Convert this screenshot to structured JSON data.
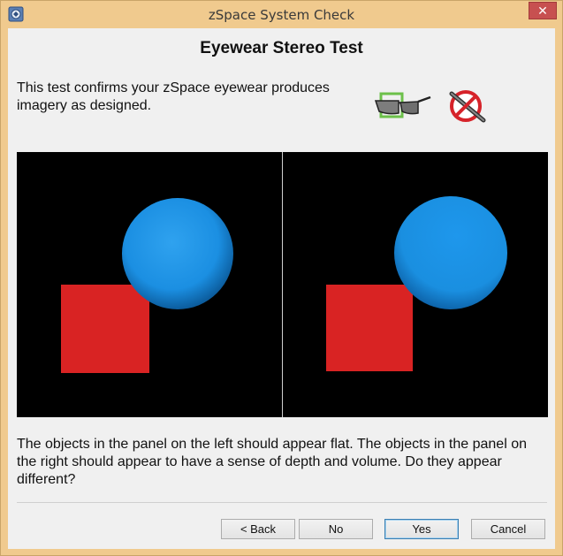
{
  "window": {
    "title": "zSpace System Check",
    "close_glyph": "✕"
  },
  "page": {
    "heading": "Eyewear Stereo Test",
    "intro": "This test confirms your zSpace eyewear produces imagery as designed.",
    "question": "The objects in the panel on the left should appear flat. The objects in the panel on the right should appear to have a sense of depth and volume. Do they appear different?"
  },
  "icons": {
    "app": "zspace-app-icon",
    "eyewear": "eyewear-icon",
    "no_stylus": "no-stylus-icon"
  },
  "buttons": {
    "back": "< Back",
    "no": "No",
    "yes": "Yes",
    "cancel": "Cancel"
  },
  "colors": {
    "sphere": "#1a8fe0",
    "square": "#d92323",
    "panel_bg": "#000000",
    "accent": "#3c7fb1"
  }
}
